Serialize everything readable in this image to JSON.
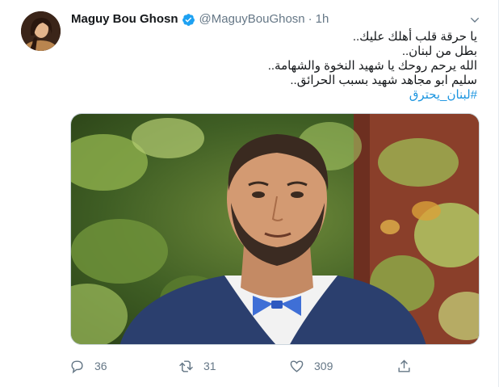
{
  "tweet": {
    "author": {
      "display_name": "Maguy Bou Ghosn",
      "handle": "@MaguyBouGhosn",
      "verified": true
    },
    "separator": "·",
    "time": "1h",
    "text_lines": [
      "يا حرقة قلب أهلك عليك..",
      "بطل من لبنان..",
      "الله يرحم روحك يا شهيد النخوة والشهامة..",
      "سليم ابو مجاهد شهيد بسبب الحرائق.."
    ],
    "hashtag": "#لبنان_يحترق",
    "media": {
      "icon": "photo-portrait"
    },
    "actions": {
      "replies": "36",
      "retweets": "31",
      "likes": "309"
    },
    "colors": {
      "link": "#1b95e0",
      "secondary": "#657786",
      "verified": "#1da1f2"
    }
  }
}
